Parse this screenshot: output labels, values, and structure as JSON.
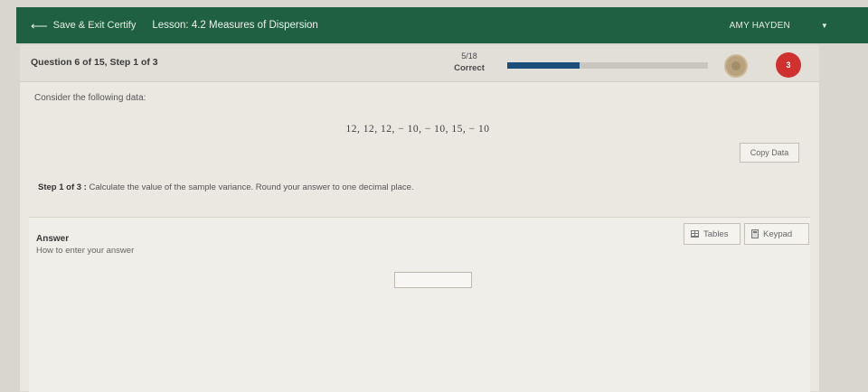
{
  "topbar": {
    "save_exit_label": "Save & Exit Certify",
    "lesson_title": "Lesson: 4.2 Measures of Dispersion",
    "user_name": "AMY HAYDEN",
    "back_icon": "arrow-left-icon",
    "menu_icon": "caret-down-icon",
    "bg_color": "#1e6040"
  },
  "question_header": {
    "title": "Question 6 of 15, Step 1 of 3",
    "score_fraction": "5/18",
    "score_label": "Correct",
    "progress_fraction": 0.36,
    "progress_color": "#1c4e7c",
    "hearts": "3",
    "heart_color": "#d0312f"
  },
  "question": {
    "intro": "Consider the following data:",
    "data": "12, 12, 12, − 10, − 10, 15, − 10",
    "copy_button": "Copy Data",
    "step_label": "Step 1 of 3 :",
    "step_text": " Calculate the value of the sample variance. Round your answer to one decimal place."
  },
  "answer": {
    "title": "Answer",
    "howto_link": "How to enter your answer",
    "tables_button": "Tables",
    "keypad_button": "Keypad",
    "input_value": ""
  }
}
